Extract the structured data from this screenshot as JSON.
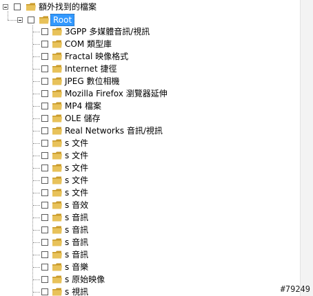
{
  "tree": {
    "root_top": {
      "label": "額外找到的檔案"
    },
    "root": {
      "label": "Root"
    },
    "items": [
      {
        "label": "3GPP 多媒體音訊/視訊"
      },
      {
        "label": "COM 類型庫"
      },
      {
        "label": "Fractal 映像格式"
      },
      {
        "label": "Internet 捷徑"
      },
      {
        "label": "JPEG 數位相機"
      },
      {
        "label": "Mozilla Firefox 瀏覽器延伸"
      },
      {
        "label": "MP4 檔案"
      },
      {
        "label": "OLE 儲存"
      },
      {
        "label": "Real Networks 音訊/視訊"
      },
      {
        "label": "s 文件"
      },
      {
        "label": "s 文件"
      },
      {
        "label": "s 文件"
      },
      {
        "label": "s 文件"
      },
      {
        "label": "s 文件"
      },
      {
        "label": "s 音效"
      },
      {
        "label": "s 音訊"
      },
      {
        "label": "s 音訊"
      },
      {
        "label": "s 音訊"
      },
      {
        "label": "s 音訊"
      },
      {
        "label": "s 音樂"
      },
      {
        "label": "s 原始映像"
      },
      {
        "label": "s 視訊"
      }
    ]
  },
  "watermark": "#79249",
  "colors": {
    "selection": "#3399ff",
    "folder": "#e8c25a",
    "folder_dark": "#c99a2a"
  }
}
